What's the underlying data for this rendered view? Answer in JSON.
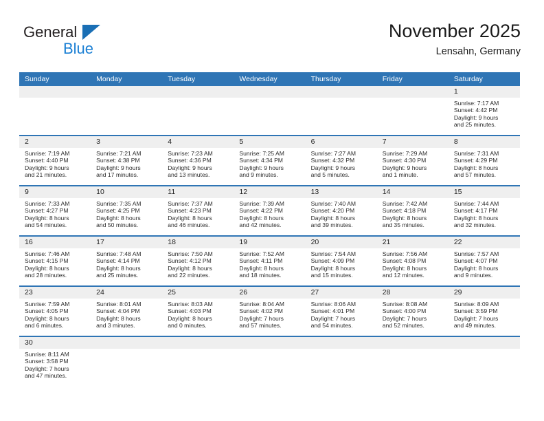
{
  "logo": {
    "word1": "General",
    "word2": "Blue",
    "triangle_color": "#1a6fb5",
    "word2_color": "#1a7fd4"
  },
  "header": {
    "title": "November 2025",
    "subtitle": "Lensahn, Germany"
  },
  "theme": {
    "header_blue": "#2f75b5",
    "date_band_gray": "#efefef",
    "cell_bg": "#ffffff",
    "text": "#222222"
  },
  "weekday_headers": [
    "Sunday",
    "Monday",
    "Tuesday",
    "Wednesday",
    "Thursday",
    "Friday",
    "Saturday"
  ],
  "weeks": [
    [
      {
        "day": "",
        "empty": true
      },
      {
        "day": "",
        "empty": true
      },
      {
        "day": "",
        "empty": true
      },
      {
        "day": "",
        "empty": true
      },
      {
        "day": "",
        "empty": true
      },
      {
        "day": "",
        "empty": true
      },
      {
        "day": "1",
        "sunrise": "Sunrise: 7:17 AM",
        "sunset": "Sunset: 4:42 PM",
        "daylight1": "Daylight: 9 hours",
        "daylight2": "and 25 minutes."
      }
    ],
    [
      {
        "day": "2",
        "sunrise": "Sunrise: 7:19 AM",
        "sunset": "Sunset: 4:40 PM",
        "daylight1": "Daylight: 9 hours",
        "daylight2": "and 21 minutes."
      },
      {
        "day": "3",
        "sunrise": "Sunrise: 7:21 AM",
        "sunset": "Sunset: 4:38 PM",
        "daylight1": "Daylight: 9 hours",
        "daylight2": "and 17 minutes."
      },
      {
        "day": "4",
        "sunrise": "Sunrise: 7:23 AM",
        "sunset": "Sunset: 4:36 PM",
        "daylight1": "Daylight: 9 hours",
        "daylight2": "and 13 minutes."
      },
      {
        "day": "5",
        "sunrise": "Sunrise: 7:25 AM",
        "sunset": "Sunset: 4:34 PM",
        "daylight1": "Daylight: 9 hours",
        "daylight2": "and 9 minutes."
      },
      {
        "day": "6",
        "sunrise": "Sunrise: 7:27 AM",
        "sunset": "Sunset: 4:32 PM",
        "daylight1": "Daylight: 9 hours",
        "daylight2": "and 5 minutes."
      },
      {
        "day": "7",
        "sunrise": "Sunrise: 7:29 AM",
        "sunset": "Sunset: 4:30 PM",
        "daylight1": "Daylight: 9 hours",
        "daylight2": "and 1 minute."
      },
      {
        "day": "8",
        "sunrise": "Sunrise: 7:31 AM",
        "sunset": "Sunset: 4:29 PM",
        "daylight1": "Daylight: 8 hours",
        "daylight2": "and 57 minutes."
      }
    ],
    [
      {
        "day": "9",
        "sunrise": "Sunrise: 7:33 AM",
        "sunset": "Sunset: 4:27 PM",
        "daylight1": "Daylight: 8 hours",
        "daylight2": "and 54 minutes."
      },
      {
        "day": "10",
        "sunrise": "Sunrise: 7:35 AM",
        "sunset": "Sunset: 4:25 PM",
        "daylight1": "Daylight: 8 hours",
        "daylight2": "and 50 minutes."
      },
      {
        "day": "11",
        "sunrise": "Sunrise: 7:37 AM",
        "sunset": "Sunset: 4:23 PM",
        "daylight1": "Daylight: 8 hours",
        "daylight2": "and 46 minutes."
      },
      {
        "day": "12",
        "sunrise": "Sunrise: 7:39 AM",
        "sunset": "Sunset: 4:22 PM",
        "daylight1": "Daylight: 8 hours",
        "daylight2": "and 42 minutes."
      },
      {
        "day": "13",
        "sunrise": "Sunrise: 7:40 AM",
        "sunset": "Sunset: 4:20 PM",
        "daylight1": "Daylight: 8 hours",
        "daylight2": "and 39 minutes."
      },
      {
        "day": "14",
        "sunrise": "Sunrise: 7:42 AM",
        "sunset": "Sunset: 4:18 PM",
        "daylight1": "Daylight: 8 hours",
        "daylight2": "and 35 minutes."
      },
      {
        "day": "15",
        "sunrise": "Sunrise: 7:44 AM",
        "sunset": "Sunset: 4:17 PM",
        "daylight1": "Daylight: 8 hours",
        "daylight2": "and 32 minutes."
      }
    ],
    [
      {
        "day": "16",
        "sunrise": "Sunrise: 7:46 AM",
        "sunset": "Sunset: 4:15 PM",
        "daylight1": "Daylight: 8 hours",
        "daylight2": "and 28 minutes."
      },
      {
        "day": "17",
        "sunrise": "Sunrise: 7:48 AM",
        "sunset": "Sunset: 4:14 PM",
        "daylight1": "Daylight: 8 hours",
        "daylight2": "and 25 minutes."
      },
      {
        "day": "18",
        "sunrise": "Sunrise: 7:50 AM",
        "sunset": "Sunset: 4:12 PM",
        "daylight1": "Daylight: 8 hours",
        "daylight2": "and 22 minutes."
      },
      {
        "day": "19",
        "sunrise": "Sunrise: 7:52 AM",
        "sunset": "Sunset: 4:11 PM",
        "daylight1": "Daylight: 8 hours",
        "daylight2": "and 18 minutes."
      },
      {
        "day": "20",
        "sunrise": "Sunrise: 7:54 AM",
        "sunset": "Sunset: 4:09 PM",
        "daylight1": "Daylight: 8 hours",
        "daylight2": "and 15 minutes."
      },
      {
        "day": "21",
        "sunrise": "Sunrise: 7:56 AM",
        "sunset": "Sunset: 4:08 PM",
        "daylight1": "Daylight: 8 hours",
        "daylight2": "and 12 minutes."
      },
      {
        "day": "22",
        "sunrise": "Sunrise: 7:57 AM",
        "sunset": "Sunset: 4:07 PM",
        "daylight1": "Daylight: 8 hours",
        "daylight2": "and 9 minutes."
      }
    ],
    [
      {
        "day": "23",
        "sunrise": "Sunrise: 7:59 AM",
        "sunset": "Sunset: 4:05 PM",
        "daylight1": "Daylight: 8 hours",
        "daylight2": "and 6 minutes."
      },
      {
        "day": "24",
        "sunrise": "Sunrise: 8:01 AM",
        "sunset": "Sunset: 4:04 PM",
        "daylight1": "Daylight: 8 hours",
        "daylight2": "and 3 minutes."
      },
      {
        "day": "25",
        "sunrise": "Sunrise: 8:03 AM",
        "sunset": "Sunset: 4:03 PM",
        "daylight1": "Daylight: 8 hours",
        "daylight2": "and 0 minutes."
      },
      {
        "day": "26",
        "sunrise": "Sunrise: 8:04 AM",
        "sunset": "Sunset: 4:02 PM",
        "daylight1": "Daylight: 7 hours",
        "daylight2": "and 57 minutes."
      },
      {
        "day": "27",
        "sunrise": "Sunrise: 8:06 AM",
        "sunset": "Sunset: 4:01 PM",
        "daylight1": "Daylight: 7 hours",
        "daylight2": "and 54 minutes."
      },
      {
        "day": "28",
        "sunrise": "Sunrise: 8:08 AM",
        "sunset": "Sunset: 4:00 PM",
        "daylight1": "Daylight: 7 hours",
        "daylight2": "and 52 minutes."
      },
      {
        "day": "29",
        "sunrise": "Sunrise: 8:09 AM",
        "sunset": "Sunset: 3:59 PM",
        "daylight1": "Daylight: 7 hours",
        "daylight2": "and 49 minutes."
      }
    ],
    [
      {
        "day": "30",
        "sunrise": "Sunrise: 8:11 AM",
        "sunset": "Sunset: 3:58 PM",
        "daylight1": "Daylight: 7 hours",
        "daylight2": "and 47 minutes."
      },
      {
        "day": "",
        "empty": true
      },
      {
        "day": "",
        "empty": true
      },
      {
        "day": "",
        "empty": true
      },
      {
        "day": "",
        "empty": true
      },
      {
        "day": "",
        "empty": true
      },
      {
        "day": "",
        "empty": true
      }
    ]
  ]
}
